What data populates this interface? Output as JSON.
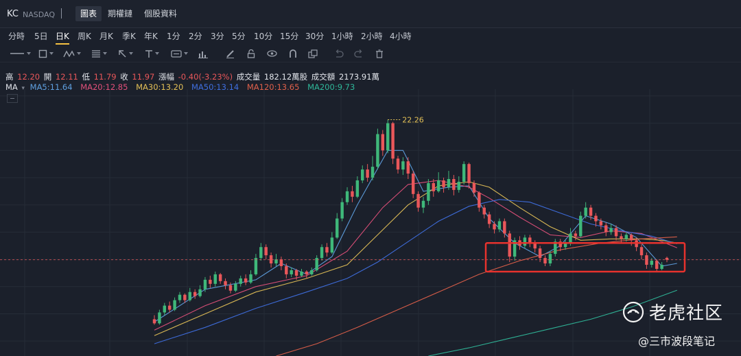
{
  "header": {
    "symbol": "KC",
    "exchange": "NASDAQ",
    "tabs": [
      {
        "label": "圖表",
        "active": true
      },
      {
        "label": "期權鏈",
        "active": false
      },
      {
        "label": "個股資料",
        "active": false
      }
    ]
  },
  "timeframes": [
    {
      "label": "分時",
      "active": false
    },
    {
      "label": "5日",
      "active": false
    },
    {
      "label": "日K",
      "active": true
    },
    {
      "label": "周K",
      "active": false
    },
    {
      "label": "月K",
      "active": false
    },
    {
      "label": "季K",
      "active": false
    },
    {
      "label": "年K",
      "active": false
    },
    {
      "label": "1分",
      "active": false
    },
    {
      "label": "2分",
      "active": false
    },
    {
      "label": "3分",
      "active": false
    },
    {
      "label": "5分",
      "active": false
    },
    {
      "label": "10分",
      "active": false
    },
    {
      "label": "15分",
      "active": false
    },
    {
      "label": "30分",
      "active": false
    },
    {
      "label": "1小時",
      "active": false
    },
    {
      "label": "2小時",
      "active": false
    },
    {
      "label": "4小時",
      "active": false
    }
  ],
  "drawing_tools": [
    "line-tool-icon",
    "rectangle-tool-icon",
    "wave-tool-icon",
    "fib-tool-icon",
    "arrow-tool-icon",
    "text-tool-icon",
    "label-tool-icon",
    "indicator-tool-icon",
    "pencil-icon",
    "lock-icon",
    "eye-icon",
    "magnet-icon",
    "copy-icon",
    "undo-icon",
    "redo-icon",
    "trash-icon"
  ],
  "quote": {
    "high_label": "高",
    "high": "12.20",
    "open_label": "開",
    "open": "12.11",
    "low_label": "低",
    "low": "11.79",
    "close_label": "收",
    "close": "11.97",
    "change_label": "漲幅",
    "change": "-0.40(-3.23%)",
    "volume_label": "成交量",
    "volume": "182.12萬股",
    "turnover_label": "成交額",
    "turnover": "2173.91萬"
  },
  "ma_legend": {
    "label": "MA",
    "items": [
      {
        "text": "MA5:11.64",
        "color": "#5fa0e0"
      },
      {
        "text": "MA20:12.85",
        "color": "#e2507a"
      },
      {
        "text": "MA30:13.20",
        "color": "#e3c056"
      },
      {
        "text": "MA50:13.14",
        "color": "#3f6fe0"
      },
      {
        "text": "MA120:13.65",
        "color": "#e0604a"
      },
      {
        "text": "MA200:9.73",
        "color": "#2fb89a"
      }
    ]
  },
  "chart_data": {
    "type": "candlestick",
    "annotations": {
      "max_label": "22.26",
      "max_value": 22.26
    },
    "current_price_line": 11.97,
    "ylim": [
      4.9,
      24.5
    ],
    "highlight_box_range": [
      11.1,
      13.2
    ],
    "candles": [
      [
        7.6,
        7.3,
        7.9,
        7.2
      ],
      [
        7.3,
        8.1,
        8.3,
        7.2
      ],
      [
        8.1,
        8.6,
        8.8,
        7.9
      ],
      [
        8.6,
        8.3,
        8.9,
        8.1
      ],
      [
        8.3,
        9.0,
        9.2,
        8.2
      ],
      [
        9.0,
        9.4,
        9.6,
        8.8
      ],
      [
        9.4,
        9.0,
        9.5,
        8.8
      ],
      [
        9.0,
        9.6,
        9.9,
        8.9
      ],
      [
        9.6,
        9.3,
        9.8,
        9.1
      ],
      [
        9.3,
        9.8,
        10.1,
        9.2
      ],
      [
        9.8,
        10.5,
        10.7,
        9.6
      ],
      [
        10.5,
        10.2,
        10.8,
        9.9
      ],
      [
        10.2,
        10.9,
        11.1,
        10.0
      ],
      [
        10.9,
        10.4,
        11.0,
        10.2
      ],
      [
        10.4,
        10.1,
        10.6,
        9.8
      ],
      [
        10.1,
        9.7,
        10.3,
        9.5
      ],
      [
        9.7,
        10.2,
        10.4,
        9.6
      ],
      [
        10.2,
        10.6,
        10.8,
        10.0
      ],
      [
        10.6,
        10.3,
        10.9,
        10.1
      ],
      [
        10.3,
        10.9,
        11.2,
        10.2
      ],
      [
        10.9,
        12.1,
        12.4,
        10.8
      ],
      [
        12.1,
        12.9,
        13.2,
        11.9
      ],
      [
        12.9,
        12.3,
        13.1,
        12.0
      ],
      [
        12.3,
        11.7,
        12.5,
        11.4
      ],
      [
        11.7,
        12.0,
        12.4,
        11.5
      ],
      [
        12.0,
        11.5,
        12.2,
        11.2
      ],
      [
        11.5,
        10.9,
        11.7,
        10.6
      ],
      [
        10.9,
        11.2,
        11.4,
        10.7
      ],
      [
        11.2,
        10.8,
        11.3,
        10.5
      ],
      [
        10.8,
        11.1,
        11.3,
        10.7
      ],
      [
        11.1,
        10.9,
        11.2,
        10.6
      ],
      [
        10.9,
        11.2,
        11.4,
        10.8
      ],
      [
        11.2,
        12.1,
        12.3,
        11.1
      ],
      [
        12.1,
        12.9,
        13.1,
        11.9
      ],
      [
        12.9,
        12.5,
        13.2,
        12.2
      ],
      [
        12.5,
        13.6,
        14.0,
        12.4
      ],
      [
        13.6,
        15.0,
        15.4,
        13.5
      ],
      [
        15.0,
        16.2,
        16.5,
        14.8
      ],
      [
        16.2,
        17.0,
        17.3,
        16.0
      ],
      [
        17.0,
        16.6,
        17.4,
        16.2
      ],
      [
        16.6,
        17.8,
        18.1,
        16.5
      ],
      [
        17.8,
        18.6,
        18.9,
        17.6
      ],
      [
        18.6,
        18.0,
        19.0,
        17.7
      ],
      [
        18.0,
        18.8,
        19.6,
        17.8
      ],
      [
        18.8,
        21.2,
        21.6,
        18.6
      ],
      [
        21.2,
        20.0,
        21.5,
        19.6
      ],
      [
        20.0,
        22.0,
        22.26,
        19.8
      ],
      [
        22.0,
        19.4,
        22.1,
        19.0
      ],
      [
        19.4,
        18.6,
        19.6,
        18.3
      ],
      [
        18.6,
        19.2,
        19.5,
        18.2
      ],
      [
        19.2,
        18.3,
        19.5,
        17.9
      ],
      [
        18.3,
        16.8,
        18.5,
        16.5
      ],
      [
        16.8,
        15.8,
        17.0,
        15.5
      ],
      [
        15.8,
        16.3,
        16.6,
        15.4
      ],
      [
        16.3,
        17.6,
        17.9,
        16.0
      ],
      [
        17.6,
        17.0,
        17.9,
        16.6
      ],
      [
        17.0,
        17.8,
        18.4,
        16.9
      ],
      [
        17.8,
        17.3,
        18.0,
        16.9
      ],
      [
        17.3,
        17.9,
        18.5,
        17.1
      ],
      [
        17.9,
        17.1,
        18.2,
        16.7
      ],
      [
        17.1,
        17.7,
        18.1,
        16.9
      ],
      [
        17.7,
        19.0,
        19.2,
        17.5
      ],
      [
        19.0,
        17.6,
        19.1,
        17.2
      ],
      [
        17.6,
        16.9,
        17.8,
        16.6
      ],
      [
        16.9,
        15.8,
        17.0,
        15.5
      ],
      [
        15.8,
        15.3,
        16.0,
        15.0
      ],
      [
        15.3,
        14.6,
        15.5,
        14.3
      ],
      [
        14.6,
        14.2,
        14.8,
        13.9
      ],
      [
        14.2,
        14.8,
        15.0,
        14.0
      ],
      [
        14.8,
        13.9,
        15.0,
        13.6
      ],
      [
        13.9,
        12.2,
        14.1,
        11.8
      ],
      [
        12.2,
        13.4,
        13.6,
        11.9
      ],
      [
        13.4,
        13.0,
        13.7,
        12.7
      ],
      [
        13.0,
        13.6,
        13.8,
        12.8
      ],
      [
        13.6,
        13.2,
        13.8,
        12.9
      ],
      [
        13.2,
        12.8,
        13.4,
        12.5
      ],
      [
        12.8,
        12.1,
        13.0,
        11.8
      ],
      [
        12.1,
        11.7,
        12.3,
        11.5
      ],
      [
        11.7,
        12.4,
        12.6,
        11.5
      ],
      [
        12.4,
        13.3,
        13.5,
        12.2
      ],
      [
        13.3,
        12.9,
        13.5,
        12.6
      ],
      [
        12.9,
        13.2,
        13.4,
        12.7
      ],
      [
        13.2,
        13.9,
        14.3,
        13.0
      ],
      [
        13.9,
        13.7,
        14.1,
        13.4
      ],
      [
        13.7,
        15.2,
        15.5,
        13.6
      ],
      [
        15.2,
        15.8,
        16.2,
        15.0
      ],
      [
        15.8,
        15.2,
        16.0,
        14.9
      ],
      [
        15.2,
        14.8,
        15.4,
        14.4
      ],
      [
        14.8,
        14.5,
        15.0,
        14.2
      ],
      [
        14.5,
        14.0,
        14.7,
        13.7
      ],
      [
        14.0,
        14.3,
        14.6,
        13.8
      ],
      [
        14.3,
        13.7,
        14.5,
        13.4
      ],
      [
        13.7,
        13.5,
        13.9,
        13.2
      ],
      [
        13.5,
        13.8,
        14.0,
        13.3
      ],
      [
        13.8,
        13.4,
        13.9,
        13.0
      ],
      [
        13.4,
        12.9,
        13.6,
        12.6
      ],
      [
        12.9,
        12.3,
        13.1,
        12.0
      ],
      [
        12.3,
        11.6,
        12.5,
        11.3
      ],
      [
        11.6,
        11.9,
        12.1,
        11.4
      ],
      [
        11.9,
        11.3,
        12.0,
        11.1
      ],
      [
        11.3,
        11.6,
        11.8,
        11.2
      ],
      [
        12.11,
        11.97,
        12.2,
        11.79
      ]
    ],
    "moving_averages": [
      {
        "name": "MA5",
        "color": "#5fa0e0",
        "points": [
          [
            0,
            7.4
          ],
          [
            10,
            9.8
          ],
          [
            20,
            10.5
          ],
          [
            25,
            11.7
          ],
          [
            30,
            10.9
          ],
          [
            35,
            12.2
          ],
          [
            40,
            16.0
          ],
          [
            46,
            20.0
          ],
          [
            49,
            20.0
          ],
          [
            53,
            17.0
          ],
          [
            58,
            17.3
          ],
          [
            62,
            17.4
          ],
          [
            66,
            15.0
          ],
          [
            71,
            13.2
          ],
          [
            76,
            12.2
          ],
          [
            80,
            13.0
          ],
          [
            85,
            15.2
          ],
          [
            90,
            14.6
          ],
          [
            95,
            13.6
          ],
          [
            100,
            11.5
          ],
          [
            103,
            11.7
          ]
        ]
      },
      {
        "name": "MA20",
        "color": "#e2507a",
        "points": [
          [
            0,
            6.8
          ],
          [
            10,
            8.6
          ],
          [
            20,
            10.0
          ],
          [
            30,
            10.8
          ],
          [
            38,
            12.6
          ],
          [
            45,
            15.8
          ],
          [
            50,
            17.5
          ],
          [
            56,
            17.8
          ],
          [
            62,
            17.3
          ],
          [
            66,
            16.5
          ],
          [
            72,
            15.1
          ],
          [
            78,
            13.8
          ],
          [
            84,
            13.6
          ],
          [
            90,
            14.1
          ],
          [
            96,
            13.9
          ],
          [
            100,
            13.3
          ],
          [
            103,
            12.85
          ]
        ]
      },
      {
        "name": "MA30",
        "color": "#e3c056",
        "points": [
          [
            0,
            6.4
          ],
          [
            10,
            8.0
          ],
          [
            20,
            9.6
          ],
          [
            30,
            10.6
          ],
          [
            38,
            11.6
          ],
          [
            44,
            13.8
          ],
          [
            50,
            16.0
          ],
          [
            56,
            17.4
          ],
          [
            62,
            17.7
          ],
          [
            66,
            17.3
          ],
          [
            72,
            15.8
          ],
          [
            78,
            14.4
          ],
          [
            84,
            13.4
          ],
          [
            90,
            13.5
          ],
          [
            96,
            13.5
          ],
          [
            100,
            13.4
          ],
          [
            103,
            13.2
          ]
        ]
      },
      {
        "name": "MA50",
        "color": "#3f6fe0",
        "points": [
          [
            0,
            5.8
          ],
          [
            10,
            7.0
          ],
          [
            20,
            8.4
          ],
          [
            30,
            9.6
          ],
          [
            38,
            10.6
          ],
          [
            44,
            11.8
          ],
          [
            50,
            13.3
          ],
          [
            56,
            14.8
          ],
          [
            62,
            15.9
          ],
          [
            68,
            16.4
          ],
          [
            74,
            16.2
          ],
          [
            80,
            15.4
          ],
          [
            86,
            14.6
          ],
          [
            92,
            14.1
          ],
          [
            98,
            13.7
          ],
          [
            103,
            13.14
          ]
        ]
      },
      {
        "name": "MA120",
        "color": "#e0604a",
        "points": [
          [
            24,
            4.9
          ],
          [
            32,
            5.8
          ],
          [
            40,
            7.0
          ],
          [
            48,
            8.3
          ],
          [
            56,
            9.6
          ],
          [
            64,
            10.9
          ],
          [
            72,
            11.9
          ],
          [
            80,
            12.7
          ],
          [
            88,
            13.2
          ],
          [
            96,
            13.5
          ],
          [
            103,
            13.65
          ]
        ]
      },
      {
        "name": "MA200",
        "color": "#2fb89a",
        "points": [
          [
            54,
            4.9
          ],
          [
            62,
            5.5
          ],
          [
            70,
            6.2
          ],
          [
            78,
            6.9
          ],
          [
            86,
            7.6
          ],
          [
            94,
            8.5
          ],
          [
            103,
            9.73
          ]
        ]
      }
    ]
  },
  "watermark": {
    "brand": "老虎社区",
    "credit": "@三市波段笔记"
  }
}
